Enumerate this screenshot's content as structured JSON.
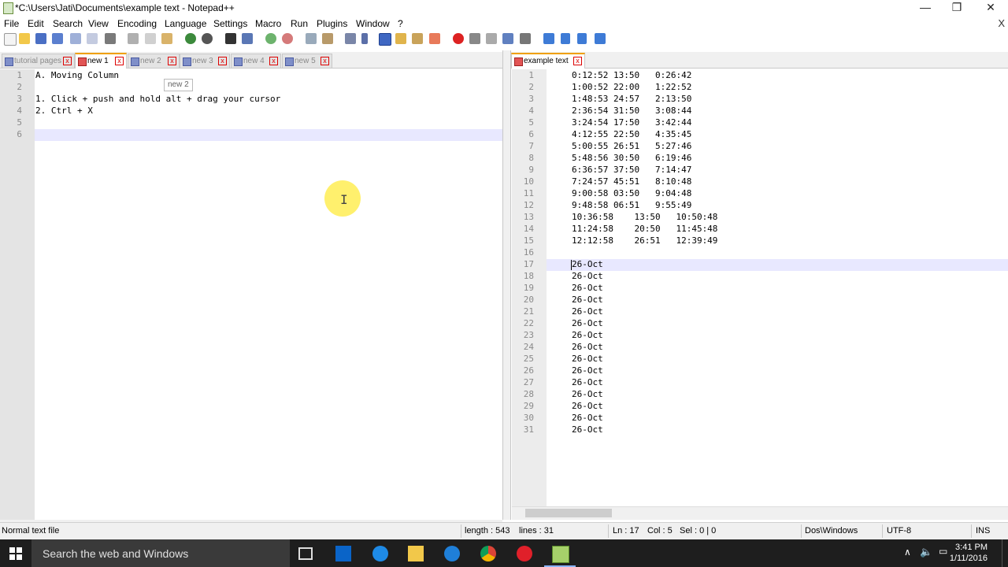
{
  "window": {
    "title": "*C:\\Users\\Jati\\Documents\\example text - Notepad++",
    "minimize": "—",
    "restore": "❐",
    "close": "✕"
  },
  "menu": [
    "File",
    "Edit",
    "Search",
    "View",
    "Encoding",
    "Language",
    "Settings",
    "Macro",
    "Run",
    "Plugins",
    "Window",
    "?"
  ],
  "menu_close": "X",
  "left_tabs": [
    {
      "label": "tutorial pages"
    },
    {
      "label": "new 1"
    },
    {
      "label": "new 2"
    },
    {
      "label": "new 3"
    },
    {
      "label": "new 4"
    },
    {
      "label": "new 5"
    }
  ],
  "right_tabs": [
    {
      "label": "example text"
    }
  ],
  "tab_close": "x",
  "tooltip": "new 2",
  "left_editor": {
    "line_numbers": [
      "1",
      "2",
      "3",
      "4",
      "5",
      "6"
    ],
    "lines": [
      "A. Moving Column",
      "",
      "1. Click + push and hold alt + drag your cursor",
      "2. Ctrl + X",
      "",
      ""
    ],
    "current_line": 6
  },
  "right_editor": {
    "line_numbers": [
      "1",
      "2",
      "3",
      "4",
      "5",
      "6",
      "7",
      "8",
      "9",
      "10",
      "11",
      "12",
      "13",
      "14",
      "15",
      "16",
      "17",
      "18",
      "19",
      "20",
      "21",
      "22",
      "23",
      "24",
      "25",
      "26",
      "27",
      "28",
      "29",
      "30",
      "31"
    ],
    "lines": [
      "0:12:52 13:50   0:26:42",
      "1:00:52 22:00   1:22:52",
      "1:48:53 24:57   2:13:50",
      "2:36:54 31:50   3:08:44",
      "3:24:54 17:50   3:42:44",
      "4:12:55 22:50   4:35:45",
      "5:00:55 26:51   5:27:46",
      "5:48:56 30:50   6:19:46",
      "6:36:57 37:50   7:14:47",
      "7:24:57 45:51   8:10:48",
      "9:00:58 03:50   9:04:48",
      "9:48:58 06:51   9:55:49",
      "10:36:58    13:50   10:50:48",
      "11:24:58    20:50   11:45:48",
      "12:12:58    26:51   12:39:49",
      "",
      "26-Oct",
      "26-Oct",
      "26-Oct",
      "26-Oct",
      "26-Oct",
      "26-Oct",
      "26-Oct",
      "26-Oct",
      "26-Oct",
      "26-Oct",
      "26-Oct",
      "26-Oct",
      "26-Oct",
      "26-Oct",
      "26-Oct"
    ],
    "current_line": 17
  },
  "status": {
    "file_type": "Normal text file",
    "length": "length : 543",
    "lines": "lines : 31",
    "ln": "Ln : 17",
    "col": "Col : 5",
    "sel": "Sel : 0 | 0",
    "eol": "Dos\\Windows",
    "encoding": "UTF-8",
    "mode": "INS"
  },
  "taskbar": {
    "search_placeholder": "Search the web and Windows",
    "time": "3:41 PM",
    "date": "1/11/2016"
  },
  "colors": {
    "active_tab_accent": "#f0a000",
    "current_line_bg": "#e8e8ff",
    "cursor_highlight": "#ffeb3c"
  }
}
